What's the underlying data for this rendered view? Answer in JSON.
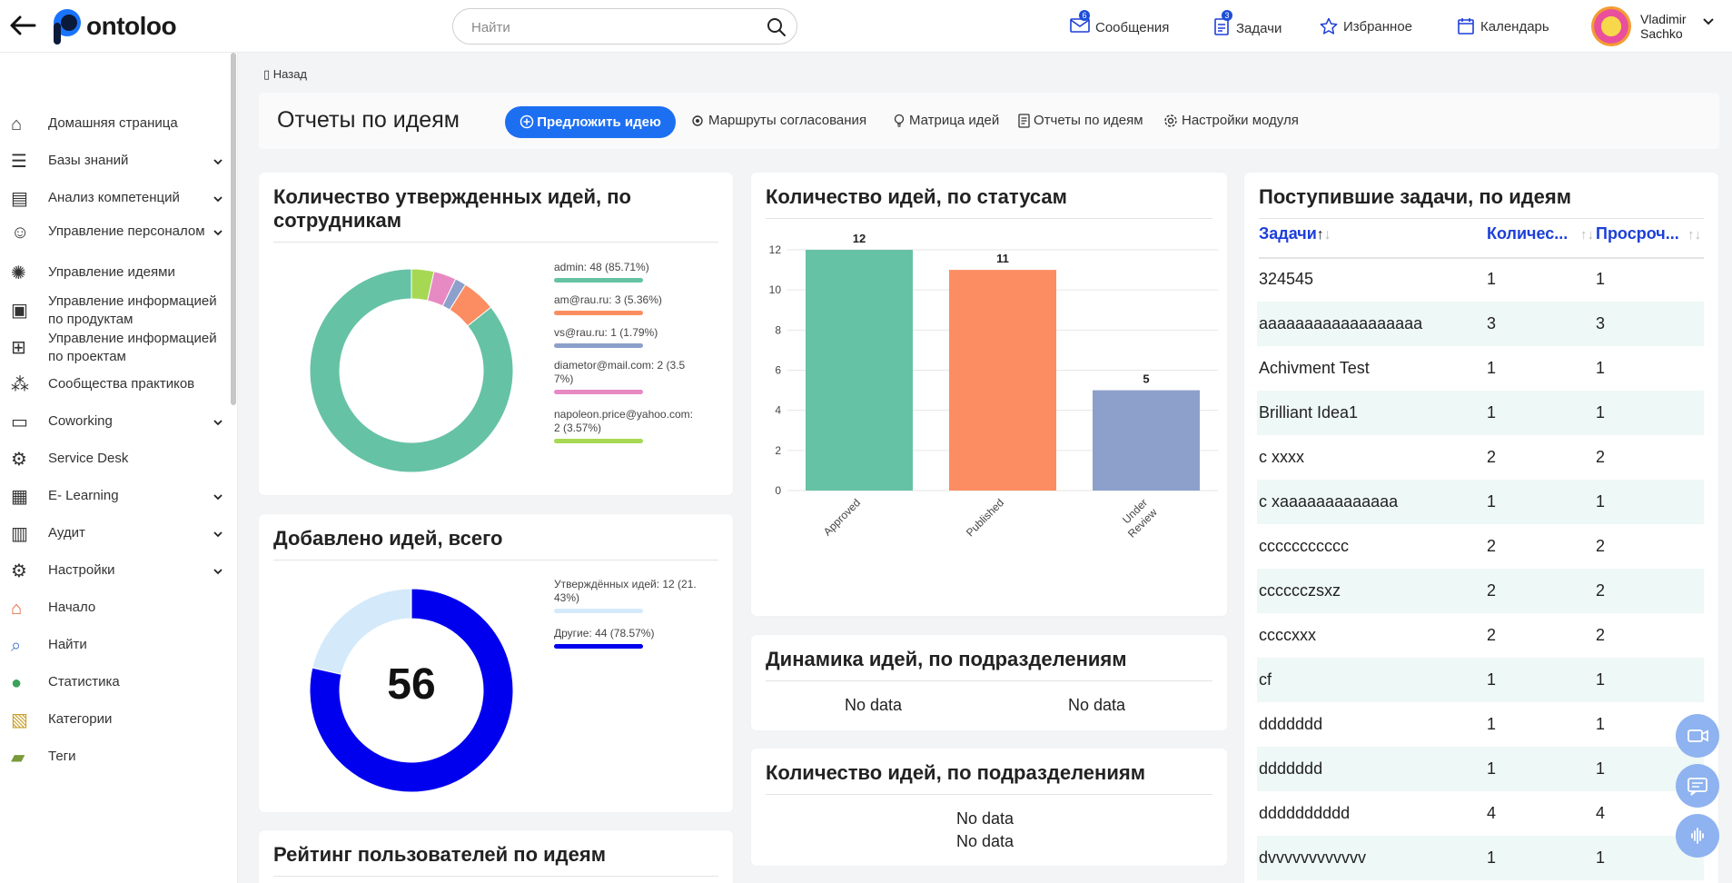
{
  "header": {
    "logo_text": "ontoloo",
    "search_placeholder": "Найти",
    "nav": [
      {
        "label": "Сообщения",
        "badge": "6"
      },
      {
        "label": "Задачи",
        "badge": "3"
      },
      {
        "label": "Избранное"
      },
      {
        "label": "Календарь"
      }
    ],
    "user_first": "Vladimir",
    "user_last": "Sachko"
  },
  "sidebar": {
    "items": [
      {
        "label": "Домашняя страница",
        "icon": "home-icon",
        "expandable": false
      },
      {
        "label": "Базы знаний",
        "icon": "database-icon",
        "expandable": true
      },
      {
        "label": "Анализ компетенций",
        "icon": "analysis-icon",
        "expandable": true
      },
      {
        "label": "Управление персоналом",
        "icon": "person-icon",
        "expandable": true
      },
      {
        "label": "Управление идеями",
        "icon": "lightbulb-icon",
        "expandable": false
      },
      {
        "label": "Управление информацией по продуктам",
        "icon": "product-icon",
        "expandable": false
      },
      {
        "label": "Управление информацией по проектам",
        "icon": "project-icon",
        "expandable": false
      },
      {
        "label": "Сообщества практиков",
        "icon": "community-icon",
        "expandable": false
      },
      {
        "label": "Coworking",
        "icon": "folder-icon",
        "expandable": true
      },
      {
        "label": "Service Desk",
        "icon": "gear-icon",
        "expandable": false
      },
      {
        "label": "E- Learning",
        "icon": "learning-icon",
        "expandable": true
      },
      {
        "label": "Аудит",
        "icon": "briefcase-icon",
        "expandable": true
      },
      {
        "label": "Настройки",
        "icon": "settings-icon",
        "expandable": true
      },
      {
        "label": "Начало",
        "icon": "house-icon",
        "expandable": false
      },
      {
        "label": "Найти",
        "icon": "magnifier-icon",
        "expandable": false
      },
      {
        "label": "Статистика",
        "icon": "globe-icon",
        "expandable": false
      },
      {
        "label": "Категории",
        "icon": "clipboard-icon",
        "expandable": false
      },
      {
        "label": "Теги",
        "icon": "tag-icon",
        "expandable": false
      }
    ]
  },
  "breadcrumb": "Назад",
  "toolbar": {
    "title": "Отчеты по идеям",
    "propose_label": "Предложить идею",
    "links": [
      "Маршруты согласования",
      "Матрица идей",
      "Отчеты по идеям",
      "Настройки модуля"
    ]
  },
  "cards": {
    "approved_title": "Количество утвержденных идей, по сотрудникам",
    "approved_legend": [
      {
        "text": "admin: 48 (85.71%)",
        "color": "#66c2a5"
      },
      {
        "text": "am@rau.ru: 3 (5.36%)",
        "color": "#fc8d62"
      },
      {
        "text": "vs@rau.ru: 1 (1.79%)",
        "color": "#8da0cb"
      },
      {
        "text": "diametor@mail.com: 2 (3.57%)",
        "color": "#e78ac3"
      },
      {
        "text": "napoleon.price@yahoo.com: 2 (3.57%)",
        "color": "#a6d854"
      }
    ],
    "added_title": "Добавлено идей, всего",
    "added_total": "56",
    "added_legend": [
      {
        "text": "Утверждённых идей: 12 (21.43%)",
        "color": "#d4eafb"
      },
      {
        "text": "Другие: 44 (78.57%)",
        "color": "#0000ee"
      }
    ],
    "rating_title": "Рейтинг пользователей по идеям",
    "status_title": "Количество идей, по статусам",
    "dynamics_title": "Динамика идей, по подразделениям",
    "dynamics_nodata": [
      "No data",
      "No data"
    ],
    "by_dept_title": "Количество идей, по подразделениям",
    "by_dept_nodata": [
      "No data",
      "No data"
    ],
    "tasks_title": "Поступившие задачи, по идеям"
  },
  "chart_data": [
    {
      "type": "pie",
      "title": "Количество утвержденных идей, по сотрудникам",
      "labels": [
        "admin",
        "am@rau.ru",
        "vs@rau.ru",
        "diametor@mail.com",
        "napoleon.price@yahoo.com"
      ],
      "values": [
        48,
        3,
        1,
        2,
        2
      ],
      "colors": [
        "#66c2a5",
        "#fc8d62",
        "#8da0cb",
        "#e78ac3",
        "#a6d854"
      ],
      "donut": true,
      "legend": "right"
    },
    {
      "type": "pie",
      "title": "Добавлено идей, всего",
      "labels": [
        "Утверждённых идей",
        "Другие"
      ],
      "values": [
        12,
        44
      ],
      "colors": [
        "#d4eafb",
        "#0000ee"
      ],
      "donut": true,
      "center_label": "56",
      "legend": "right"
    },
    {
      "type": "bar",
      "title": "Количество идей, по статусам",
      "categories": [
        "Approved",
        "Published",
        "Under Review"
      ],
      "values": [
        12,
        11,
        5
      ],
      "colors": [
        "#66c2a5",
        "#fc8d62",
        "#8da0cb"
      ],
      "ylim": [
        0,
        12
      ],
      "yticks": [
        0,
        2,
        4,
        6,
        8,
        10,
        12
      ],
      "grid": true
    }
  ],
  "tasks_table": {
    "headers": [
      "Задачи",
      "Количес...",
      "Просроч..."
    ],
    "rows": [
      [
        "324545",
        "1",
        "1"
      ],
      [
        "aaaaaaaaaaaaaaaaaa",
        "3",
        "3"
      ],
      [
        "Achivment Test",
        "1",
        "1"
      ],
      [
        "Brilliant Idea1",
        "1",
        "1"
      ],
      [
        "c xxxx",
        "2",
        "2"
      ],
      [
        "c xaaaaaaaaaaaaa",
        "1",
        "1"
      ],
      [
        "ccccccccccc",
        "2",
        "2"
      ],
      [
        "cccccczsxz",
        "2",
        "2"
      ],
      [
        "ccccxxx",
        "2",
        "2"
      ],
      [
        "cf",
        "1",
        "1"
      ],
      [
        "ddddddd",
        "1",
        "1"
      ],
      [
        "ddddddd",
        "1",
        "1"
      ],
      [
        "dddddddddd",
        "4",
        "4"
      ],
      [
        "dvvvvvvvvvvvv",
        "1",
        "1"
      ]
    ]
  }
}
